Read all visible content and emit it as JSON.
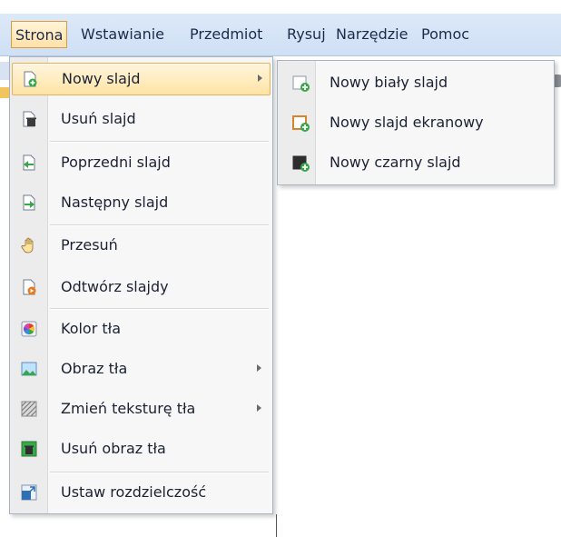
{
  "menubar": {
    "items": [
      "Strona",
      "Wstawianie",
      "Przedmiot",
      "Rysuj",
      "Narzędzie",
      "Pomoc"
    ],
    "active": "Strona"
  },
  "menu": {
    "items": [
      {
        "label": "Nowy slajd",
        "icon": "new-slide-icon",
        "submenu": true,
        "highlighted": true
      },
      {
        "label": "Usuń slajd",
        "icon": "delete-slide-icon"
      },
      {
        "label": "Poprzedni slajd",
        "icon": "previous-slide-icon"
      },
      {
        "label": "Następny slajd",
        "icon": "next-slide-icon"
      },
      {
        "label": "Przesuń",
        "icon": "hand-icon"
      },
      {
        "label": "Odtwórz slajdy",
        "icon": "play-slides-icon"
      },
      {
        "label": "Kolor tła",
        "icon": "color-wheel-icon"
      },
      {
        "label": "Obraz tła",
        "icon": "image-icon",
        "submenu": true
      },
      {
        "label": "Zmień teksturę tła",
        "icon": "texture-icon",
        "submenu": true
      },
      {
        "label": "Usuń obraz tła",
        "icon": "delete-image-icon"
      },
      {
        "label": "Ustaw rozdzielczość",
        "icon": "resolution-icon"
      }
    ]
  },
  "submenu": {
    "items": [
      {
        "label": "Nowy biały slajd",
        "icon": "new-white-slide-icon"
      },
      {
        "label": "Nowy slajd ekranowy",
        "icon": "new-screen-slide-icon"
      },
      {
        "label": "Nowy czarny slajd",
        "icon": "new-black-slide-icon"
      }
    ]
  },
  "colors": {
    "accent_border": "#e39a3a",
    "highlight": "#ffe3a4",
    "menubar_bg": "#cfe0f5",
    "add_green": "#3aa64a"
  }
}
